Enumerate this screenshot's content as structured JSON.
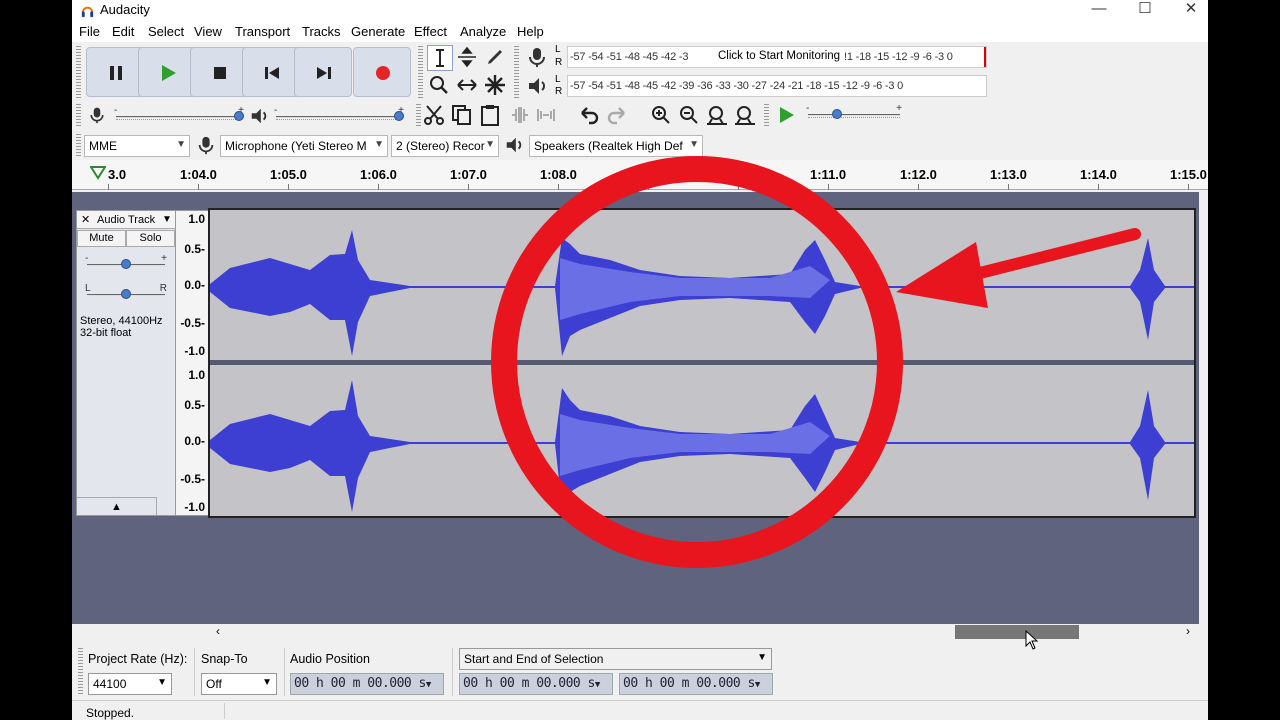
{
  "window": {
    "title": "Audacity",
    "minimize": "—",
    "maximize": "☐",
    "close": "✕"
  },
  "menu": [
    "File",
    "Edit",
    "Select",
    "View",
    "Transport",
    "Tracks",
    "Generate",
    "Effect",
    "Analyze",
    "Help"
  ],
  "transport": [
    "pause-icon",
    "play-icon",
    "stop-icon",
    "skip-start-icon",
    "skip-end-icon",
    "record-icon"
  ],
  "meters": {
    "record_scale": "-57 -54 -51 -48 -45 -42 -3",
    "record_hint": "Click to Start Monitoring",
    "record_scale_tail": "!1 -18 -15 -12  -9  -6  -3  0",
    "playback_scale": "-57 -54 -51 -48 -45 -42 -39 -36 -33 -30 -27 -24 -21 -18 -15 -12  -9  -6  -3  0",
    "L": "L",
    "R": "R"
  },
  "sliders": {
    "minus": "-",
    "plus": "+"
  },
  "devices": {
    "host": "MME",
    "input": "Microphone (Yeti Stereo M",
    "channels": "2 (Stereo) Recor",
    "output": "Speakers (Realtek High Def"
  },
  "ruler": {
    "first": "3.0",
    "labels": [
      "1:04.0",
      "1:05.0",
      "1:06.0",
      "1:07.0",
      "1:08.0",
      "1:11.0",
      "1:12.0",
      "1:13.0",
      "1:14.0",
      "1:15.0"
    ]
  },
  "track": {
    "close": "✕",
    "name": "Audio Track",
    "mute": "Mute",
    "solo": "Solo",
    "gain_minus": "-",
    "gain_plus": "+",
    "pan_left": "L",
    "pan_right": "R",
    "info_line1": "Stereo, 44100Hz",
    "info_line2": "32-bit float",
    "collapse": "▲"
  },
  "vruler": [
    "1.0",
    "0.5-",
    "0.0-",
    "-0.5-",
    "-1.0"
  ],
  "selection_bar": {
    "project_rate_label": "Project Rate (Hz):",
    "project_rate": "44100",
    "snap_label": "Snap-To",
    "snap_value": "Off",
    "audio_position_label": "Audio Position",
    "selection_mode": "Start and End of Selection",
    "time": "00 h 00 m 00.000 s"
  },
  "status": "Stopped.",
  "colors": {
    "wave": "#3c3fd2",
    "wave_light": "#6b6fe6",
    "annotation": "#e8141e",
    "track_bg": "#60637e"
  }
}
